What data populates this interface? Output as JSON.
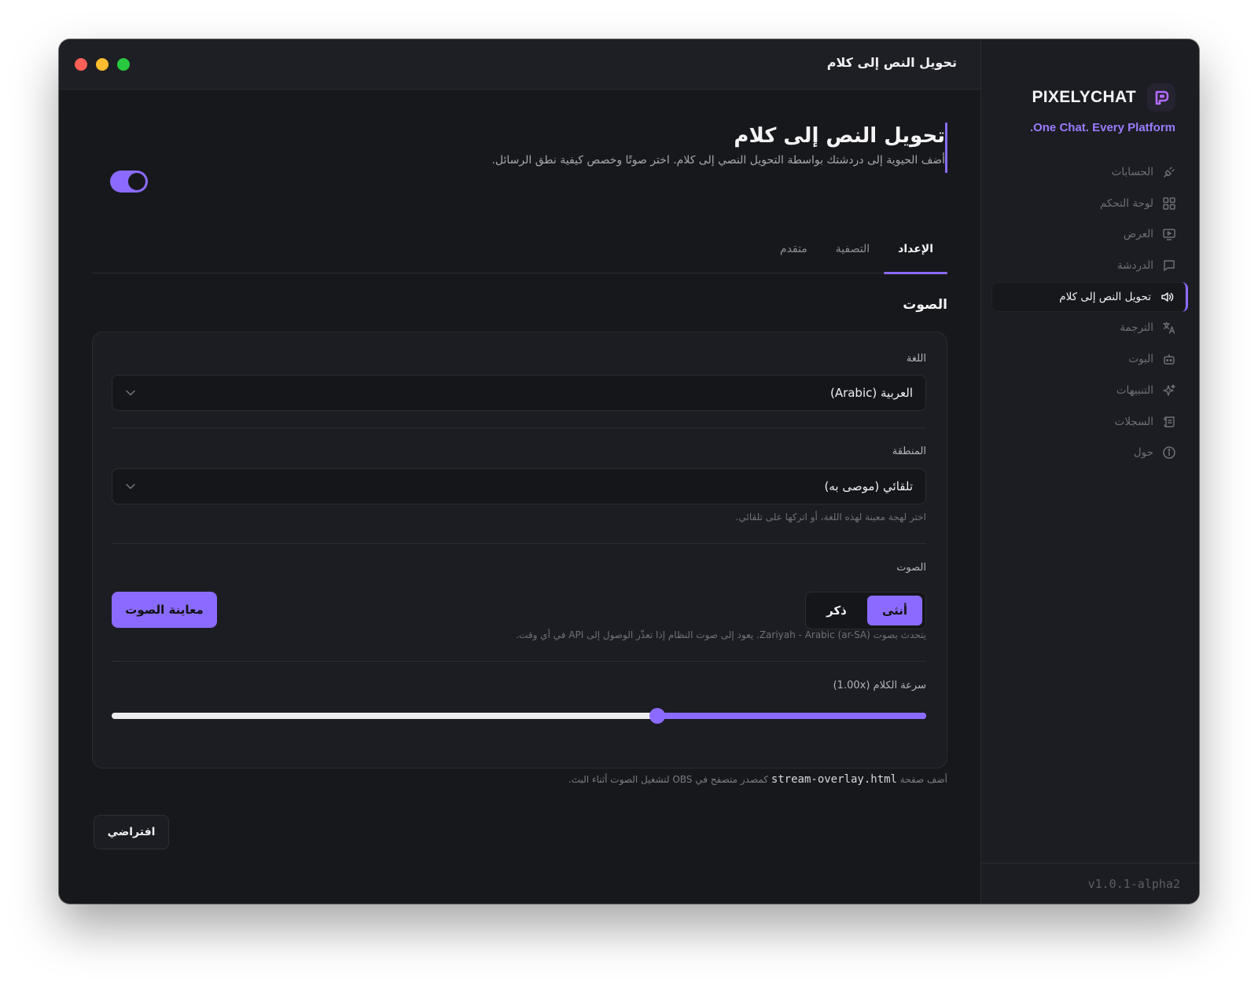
{
  "window": {
    "title": "تحويل النص إلى كلام"
  },
  "sidebar": {
    "brand_name": "PIXELYCHAT",
    "tagline": ".One Chat. Every Platform",
    "items": [
      {
        "label": "الحسابات",
        "icon": "plug-icon"
      },
      {
        "label": "لوحة التحكم",
        "icon": "grid-icon"
      },
      {
        "label": "العرض",
        "icon": "monitor-icon"
      },
      {
        "label": "الدردشة",
        "icon": "chat-icon"
      },
      {
        "label": "تحويل النص إلى كلام",
        "icon": "speaker-icon",
        "active": true
      },
      {
        "label": "الترجمة",
        "icon": "translate-icon"
      },
      {
        "label": "البوت",
        "icon": "bot-icon"
      },
      {
        "label": "التنبيهات",
        "icon": "sparkle-icon"
      },
      {
        "label": "السجلات",
        "icon": "logs-icon"
      },
      {
        "label": "حول",
        "icon": "info-icon"
      }
    ],
    "version": "v1.0.1-alpha2"
  },
  "page": {
    "title": "تحويل النص إلى كلام",
    "description": "أضف الحيوية إلى دردشتك بواسطة التحويل النصي إلى كلام. اختر صوتًا وخصص كيفية نطق الرسائل.",
    "enabled": true
  },
  "tabs": [
    {
      "label": "الإعداد",
      "active": true
    },
    {
      "label": "التصفية",
      "active": false
    },
    {
      "label": "متقدم",
      "active": false
    }
  ],
  "voice_section": {
    "title": "الصوت",
    "language_label": "اللغة",
    "language_value": "العربية (Arabic)",
    "region_label": "المنطقة",
    "region_value": "تلقائي (موصى به)",
    "region_hint": "اختر لهجة معينة لهذه اللغة، أو اتركها على تلقائي.",
    "voice_label": "الصوت",
    "voice_options": [
      {
        "label": "أنثى",
        "active": true
      },
      {
        "label": "ذكر",
        "active": false
      }
    ],
    "voice_hint": "يتحدث بصوت Zariyah - Arabic (ar-SA). يعود إلى صوت النظام إذا تعذّر الوصول إلى API في أي وقت.",
    "preview_label": "معاينة الصوت",
    "speed_label": "سرعة الكلام (1.00x)",
    "speed_fraction": 0.34
  },
  "obs_note": {
    "prefix": "أضف صفحة ",
    "file": "stream-overlay.html",
    "suffix": " كمصدر متصفح في OBS لتشغيل الصوت أثناء البث."
  },
  "reset_label": "افتراضي",
  "colors": {
    "accent": "#8b6bff",
    "background": "#17181c",
    "sidebar": "#1c1d22"
  }
}
